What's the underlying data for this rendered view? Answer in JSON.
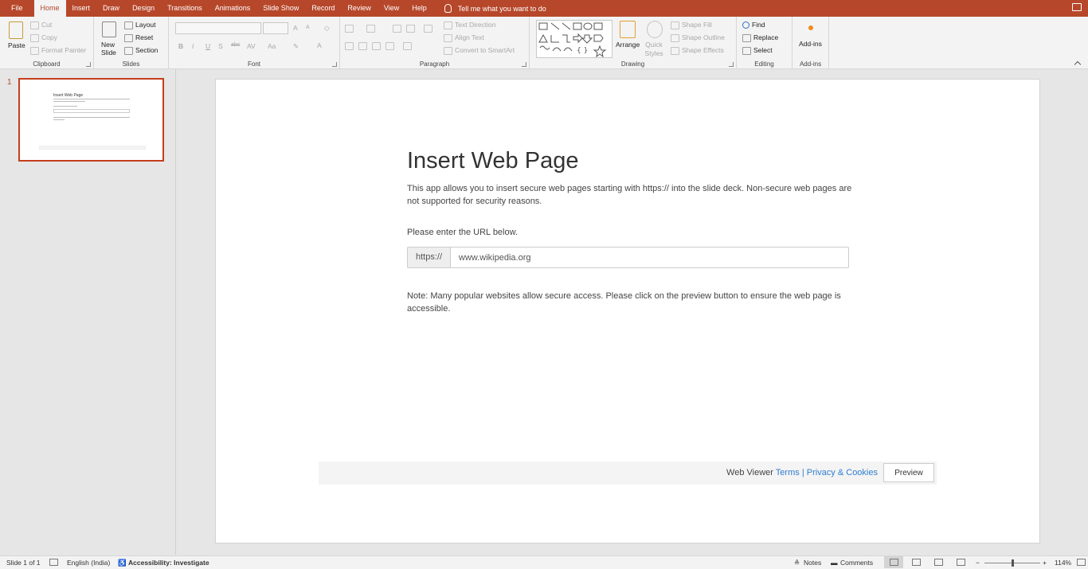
{
  "tabs": [
    "File",
    "Home",
    "Insert",
    "Draw",
    "Design",
    "Transitions",
    "Animations",
    "Slide Show",
    "Record",
    "Review",
    "View",
    "Help"
  ],
  "active_tab": "Home",
  "tell_me": "Tell me what you want to do",
  "ribbon": {
    "clipboard": {
      "label": "Clipboard",
      "paste": "Paste",
      "cut": "Cut",
      "copy": "Copy",
      "format_painter": "Format Painter"
    },
    "slides": {
      "label": "Slides",
      "new_slide": "New Slide",
      "layout": "Layout",
      "reset": "Reset",
      "section": "Section"
    },
    "font": {
      "label": "Font",
      "bold": "B",
      "italic": "I",
      "underline": "U",
      "shadow": "S",
      "strike": "abc",
      "spacing": "AV",
      "case": "Aa",
      "grow": "A",
      "shrink": "A"
    },
    "paragraph": {
      "label": "Paragraph",
      "text_direction": "Text Direction",
      "align_text": "Align Text",
      "convert_smartart": "Convert to SmartArt"
    },
    "drawing": {
      "label": "Drawing",
      "arrange": "Arrange",
      "quick_styles": "Quick Styles",
      "shape_fill": "Shape Fill",
      "shape_outline": "Shape Outline",
      "shape_effects": "Shape Effects"
    },
    "editing": {
      "label": "Editing",
      "find": "Find",
      "replace": "Replace",
      "select": "Select"
    },
    "addins": {
      "label": "Add-ins",
      "button": "Add-ins"
    }
  },
  "thumbnail": {
    "number": "1",
    "title": "Insert Web Page"
  },
  "slide": {
    "title": "Insert Web Page",
    "description": "This app allows you to insert secure web pages starting with https:// into the slide deck. Non-secure web pages are not supported for security reasons.",
    "prompt": "Please enter the URL below.",
    "url_prefix": "https://",
    "url_value": "www.wikipedia.org",
    "note": "Note: Many popular websites allow secure access. Please click on the preview button to ensure the web page is accessible.",
    "footer_brand": "Web Viewer",
    "footer_terms": "Terms",
    "footer_sep": "|",
    "footer_privacy": "Privacy & Cookies",
    "preview_button": "Preview"
  },
  "status": {
    "slide_count": "Slide 1 of 1",
    "language": "English (India)",
    "accessibility": "Accessibility: Investigate",
    "notes": "Notes",
    "comments": "Comments",
    "zoom_minus": "−",
    "zoom_plus": "+",
    "zoom": "114%"
  }
}
